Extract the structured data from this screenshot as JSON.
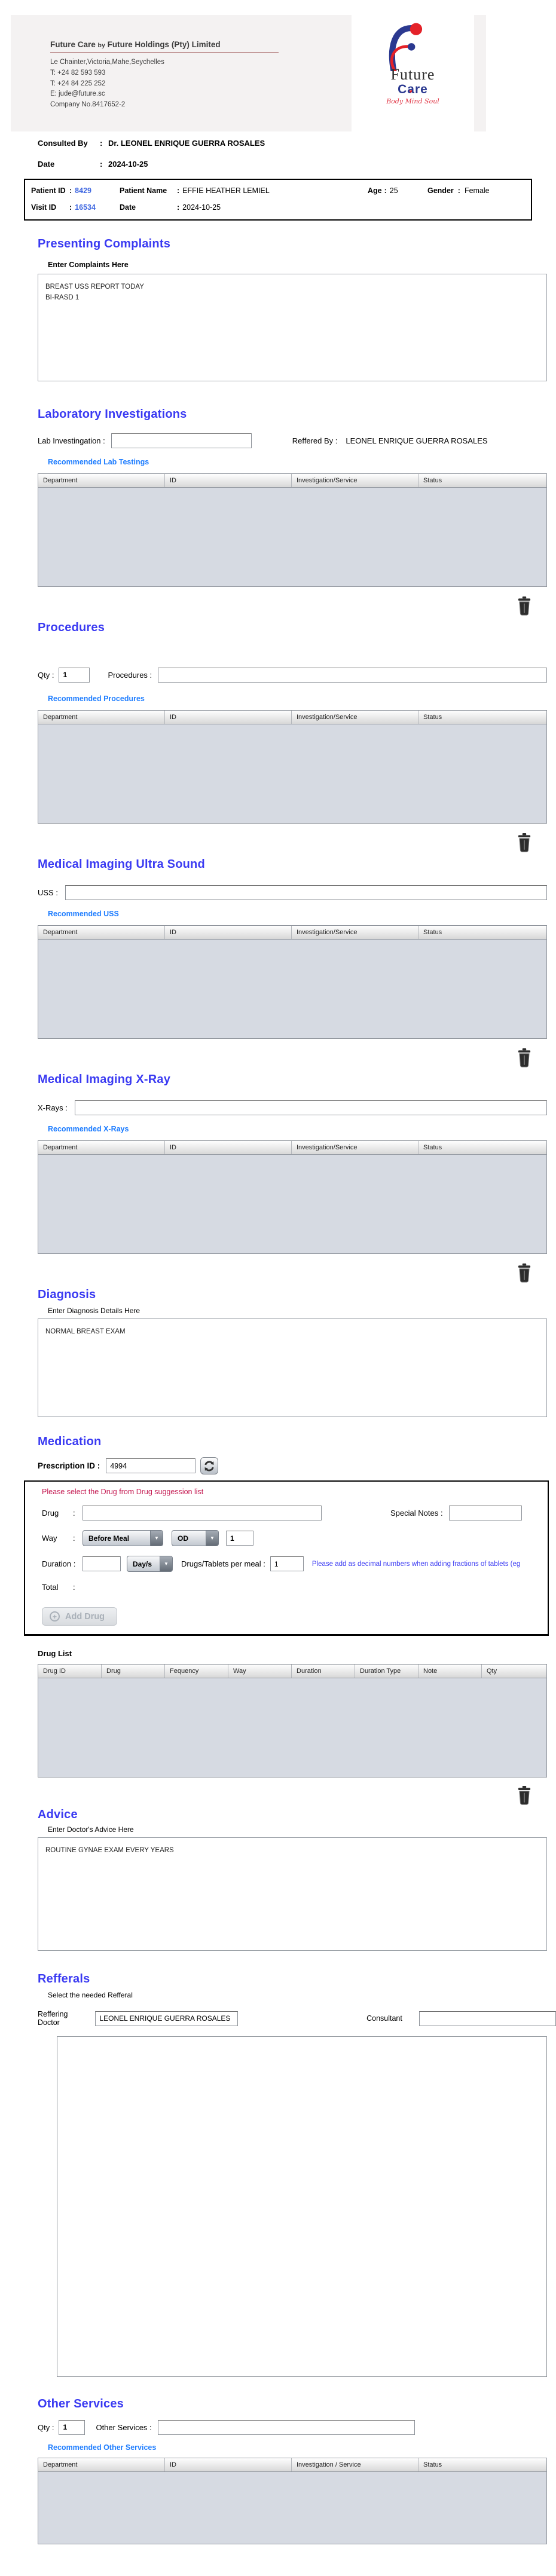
{
  "ui": {
    "colon": ":"
  },
  "colors": {
    "heading_blue": "#3a3af2",
    "link_blue": "#1e7dff",
    "id_value_blue": "#4169e1",
    "notice_red": "#c41850",
    "logo_blue": "#2b3990",
    "logo_red": "#e42229",
    "table_body_gray": "#d6dae2"
  },
  "header": {
    "company_name_main": "Future Care",
    "company_name_by": "by",
    "company_name_rest": "Future Holdings (Pty) Limited",
    "address": "Le Chainter,Victoria,Mahe,Seychelles",
    "phone1": "T: +24  82 593 593",
    "phone2": "T: +24  84 225 252",
    "email": "E: jude@future.sc",
    "company_no": "Company No.8417652-2",
    "logo": {
      "word1": "Future",
      "word2": "Care",
      "tagline": "Body Mind Soul"
    }
  },
  "consultation": {
    "consulted_by_label": "Consulted By",
    "consulted_by_value": "Dr.  LEONEL ENRIQUE GUERRA ROSALES",
    "date_label": "Date",
    "date_value": "2024-10-25"
  },
  "patient": {
    "patient_id_label": "Patient ID",
    "patient_id": "8429",
    "patient_name_label": "Patient Name",
    "patient_name": "EFFIE HEATHER LEMIEL",
    "age_label": "Age",
    "age": "25",
    "gender_label": "Gender",
    "gender": "Female",
    "visit_id_label": "Visit ID",
    "visit_id": "16534",
    "date_label": "Date",
    "date": "2024-10-25"
  },
  "presenting_complaints": {
    "title": "Presenting Complaints",
    "label": "Enter Complaints Here",
    "value": "BREAST USS REPORT TODAY\nBI-RASD 1"
  },
  "laboratory": {
    "title": "Laboratory  Investigations",
    "input_label": "Lab Investingation :",
    "input_value": "",
    "reffered_by_label": "Reffered By :",
    "reffered_by_value": "LEONEL ENRIQUE GUERRA ROSALES",
    "recommended_label": "Recommended Lab Testings",
    "columns": [
      "Department",
      "ID",
      "Investigation/Service",
      "Status"
    ]
  },
  "procedures": {
    "title": "Procedures",
    "qty_label": "Qty :",
    "qty_value": "1",
    "input_label": "Procedures :",
    "input_value": "",
    "recommended_label": "Recommended Procedures",
    "columns": [
      "Department",
      "ID",
      "Investigation/Service",
      "Status"
    ]
  },
  "uss": {
    "title": "Medical Imaging Ultra Sound",
    "input_label": "USS :",
    "input_value": "",
    "recommended_label": "Recommended USS",
    "columns": [
      "Department",
      "ID",
      "Investigation/Service",
      "Status"
    ]
  },
  "xray": {
    "title": "Medical Imaging X-Ray",
    "input_label": "X-Rays :",
    "input_value": "",
    "recommended_label": "Recommended X-Rays",
    "columns": [
      "Department",
      "ID",
      "Investigation/Service",
      "Status"
    ]
  },
  "diagnosis": {
    "title": "Diagnosis",
    "label": "Enter Diagnosis Details Here",
    "value": "NORMAL BREAST EXAM"
  },
  "medication": {
    "title": "Medication",
    "prescription_label": "Prescription ID :",
    "prescription_id": "4994",
    "notice": "Please select the Drug from Drug suggession list",
    "drug_label": "Drug",
    "drug_value": "",
    "special_notes_label": "Special Notes",
    "special_notes_value": "",
    "way_label": "Way",
    "way_select1": "Before Meal",
    "way_select2": "OD",
    "way_qty": "1",
    "duration_label": "Duration :",
    "duration_value": "",
    "duration_type": "Day/s",
    "per_meal_label": "Drugs/Tablets per meal :",
    "per_meal_value": "1",
    "fraction_note": "Please add as decimal numbers when adding fractions of tablets (eg",
    "total_label": "Total",
    "add_drug_label": "Add Drug",
    "drug_list_label": "Drug List",
    "columns": [
      "Drug ID",
      "Drug",
      "Fequency",
      "Way",
      "Duration",
      "Duration Type",
      "Note",
      "Qty"
    ]
  },
  "advice": {
    "title": "Advice",
    "label": "Enter Doctor's Advice Here",
    "value": "ROUTINE GYNAE EXAM EVERY YEARS"
  },
  "refferals": {
    "title": "Refferals",
    "label": "Select the needed Refferal",
    "reffering_doctor_label": "Reffering Doctor",
    "reffering_doctor_value": "LEONEL ENRIQUE GUERRA ROSALES",
    "consultant_label": "Consultant",
    "consultant_value": ""
  },
  "other_services": {
    "title": "Other Services",
    "qty_label": "Qty :",
    "qty_value": "1",
    "input_label": "Other Services :",
    "input_value": "",
    "recommended_label": "Recommended Other Services",
    "columns": [
      "Department",
      "ID",
      "Investigation / Service",
      "Status"
    ]
  }
}
